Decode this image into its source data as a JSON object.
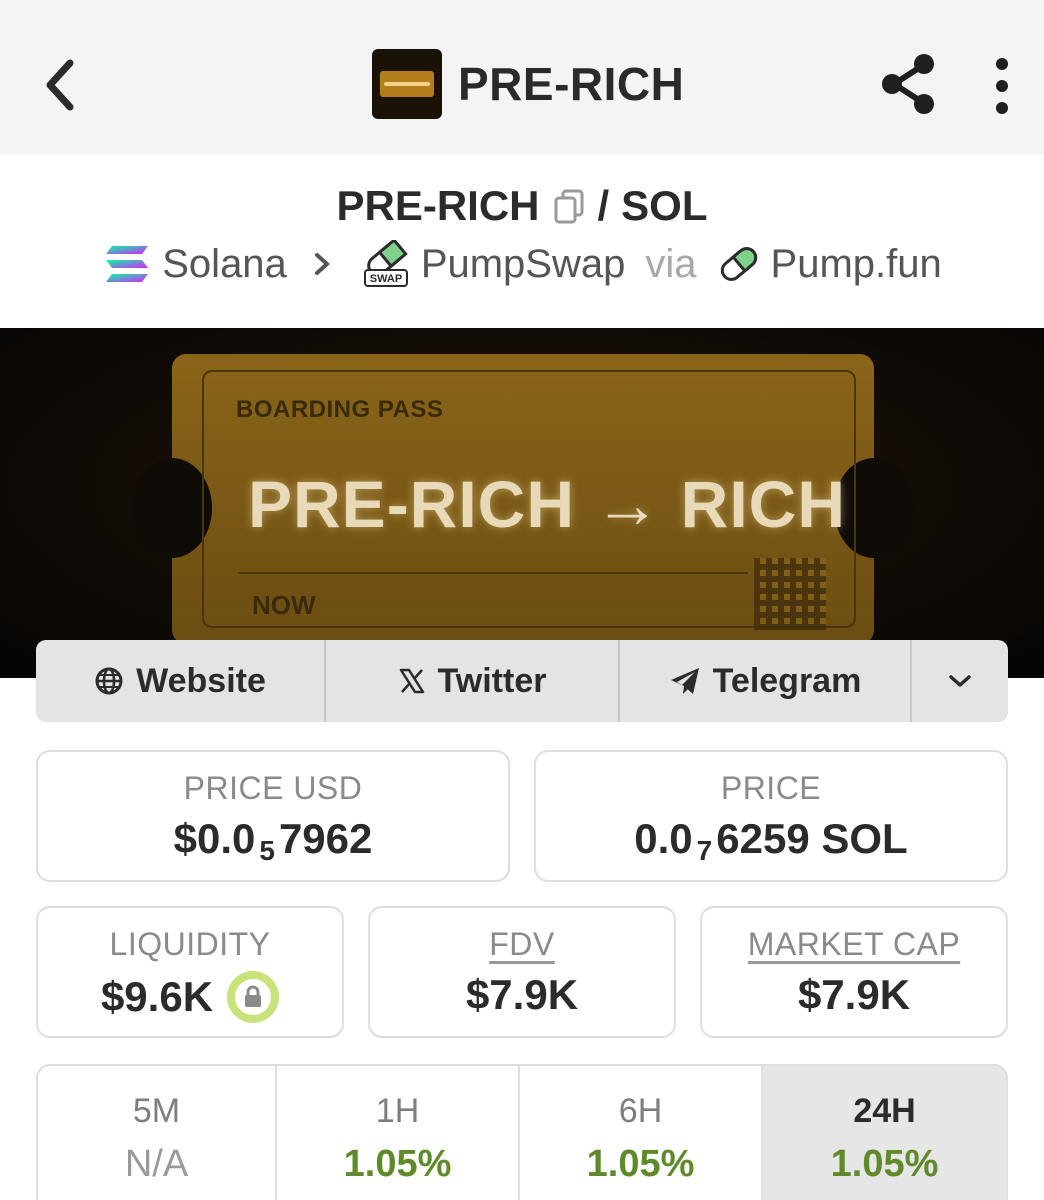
{
  "header": {
    "title": "PRE-RICH",
    "back_icon": "chevron-left-icon",
    "share_icon": "share-icon",
    "more_icon": "more-vertical-icon"
  },
  "pair": {
    "base": "PRE-RICH",
    "separator": "/",
    "quote": "SOL",
    "chain": "Solana",
    "dex": "PumpSwap",
    "via": "via",
    "launchpad": "Pump.fun"
  },
  "banner": {
    "label": "BOARDING PASS",
    "main": "PRE-RICH → RICH",
    "sub": "NOW"
  },
  "social": {
    "website": "Website",
    "twitter": "Twitter",
    "telegram": "Telegram"
  },
  "stats": {
    "price_usd": {
      "label": "PRICE USD",
      "prefix": "$0.0",
      "sub": "5",
      "suffix": "7962"
    },
    "price_sol": {
      "label": "PRICE",
      "prefix": "0.0",
      "sub": "7",
      "suffix": "6259 SOL"
    },
    "liquidity": {
      "label": "LIQUIDITY",
      "value": "$9.6K"
    },
    "fdv": {
      "label": "FDV",
      "value": "$7.9K"
    },
    "market_cap": {
      "label": "MARKET CAP",
      "value": "$7.9K"
    }
  },
  "timeframes": [
    {
      "label": "5M",
      "value": "N/A"
    },
    {
      "label": "1H",
      "value": "1.05%"
    },
    {
      "label": "6H",
      "value": "1.05%"
    },
    {
      "label": "24H",
      "value": "1.05%"
    }
  ],
  "colors": {
    "positive": "#5e8a2a",
    "na": "#9a9a9a",
    "accent_green": "#8cc63f"
  }
}
